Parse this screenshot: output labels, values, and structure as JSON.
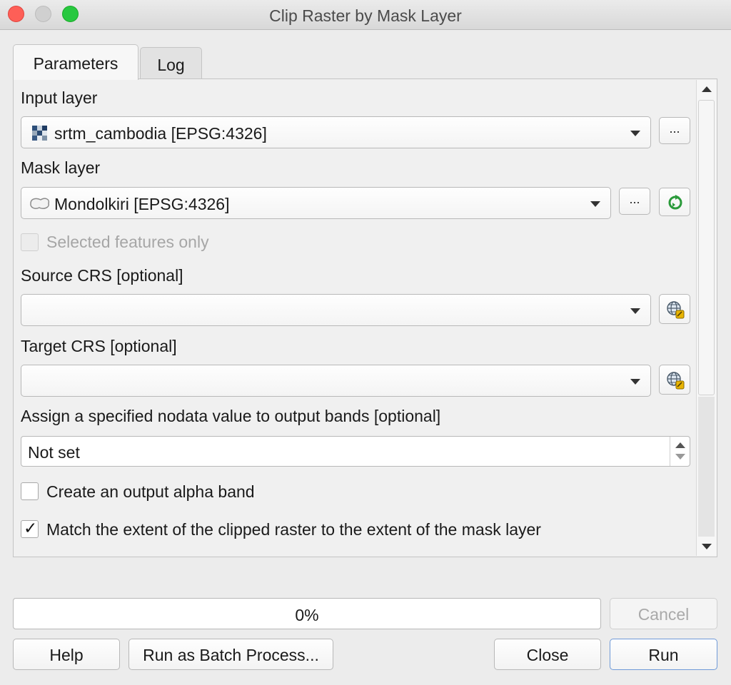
{
  "window": {
    "title": "Clip Raster by Mask Layer"
  },
  "tabs": [
    {
      "label": "Parameters"
    },
    {
      "label": "Log"
    }
  ],
  "params": {
    "input_layer": {
      "label": "Input layer",
      "value": "srtm_cambodia [EPSG:4326]",
      "browse": "..."
    },
    "mask_layer": {
      "label": "Mask layer",
      "value": "Mondolkiri [EPSG:4326]",
      "browse": "..."
    },
    "selected_only": {
      "label": "Selected features only",
      "checked": false,
      "enabled": false
    },
    "source_crs": {
      "label": "Source CRS [optional]",
      "value": ""
    },
    "target_crs": {
      "label": "Target CRS [optional]",
      "value": ""
    },
    "nodata": {
      "label": "Assign a specified nodata value to output bands [optional]",
      "value": "Not set"
    },
    "alpha_band": {
      "label": "Create an output alpha band",
      "checked": false
    },
    "match_extent": {
      "label": "Match the extent of the clipped raster to the extent of the mask layer",
      "checked": true,
      "mark": "✓"
    }
  },
  "progress": {
    "value": 0,
    "text": "0%"
  },
  "buttons": {
    "cancel": "Cancel",
    "help": "Help",
    "batch": "Run as Batch Process...",
    "close": "Close",
    "run": "Run"
  },
  "icons": {
    "raster_layer": "raster-layer-icon",
    "polygon_layer": "polygon-layer-icon",
    "iterate": "iterate-refresh-icon",
    "crs_selector": "crs-globe-icon"
  },
  "colors": {
    "close": "#fe5f57",
    "zoom": "#28c840",
    "progress": "#3b87e0",
    "iterate": "#2a9a3a"
  }
}
